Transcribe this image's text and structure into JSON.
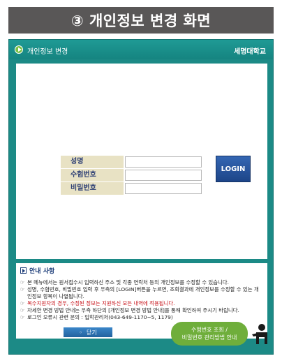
{
  "banner": {
    "title": "③ 개인정보 변경 화면"
  },
  "window": {
    "header_title": "개인정보 변경",
    "brand": "세명대학교"
  },
  "login_form": {
    "name_label": "성명",
    "exam_number_label": "수험번호",
    "password_label": "비밀번호",
    "name_value": "",
    "exam_number_value": "",
    "password_value": "",
    "login_label": "LOGIN"
  },
  "notice": {
    "title": "안내 사항",
    "items": [
      {
        "bullet": "☞",
        "text": "본 메뉴에서는 원서접수시 입력하신 주소 및 각종 연락처 등의 개인정보를 수정할 수 있습니다."
      },
      {
        "bullet": "☞",
        "text": "성명, 수험번호, 비밀번호 입력 후 우측의 [LOGIN]버튼을 누르면, 조회결과에 개인정보를 수정할 수 있는 개인정보 항목이 나열됩니다."
      },
      {
        "bullet": "☞",
        "text": "복수지원자의 경우, 수정된 정보는 지원하신 모든 내역에 적용됩니다."
      },
      {
        "bullet": "☞",
        "text": "자세한 변경 방법 안내는 우측 하단의 [개인정보 변경 방법 안내]를 통해 확인하여 주시기 바랍니다."
      },
      {
        "bullet": "☞",
        "text": "로그인 오류시 관련 문의 : 입학관리처(043-649-1170~5, 1179)"
      }
    ]
  },
  "footer": {
    "close_label": "닫기",
    "guide_line1": "수험번호 조회 /",
    "guide_line2": "비밀번호 관리방법 안내"
  },
  "colors": {
    "frame_teal": "#1c8a86",
    "banner_gray": "#595757",
    "login_blue": "#1d4588",
    "notice_red": "#c8141b",
    "guide_green": "#6fae3b"
  }
}
